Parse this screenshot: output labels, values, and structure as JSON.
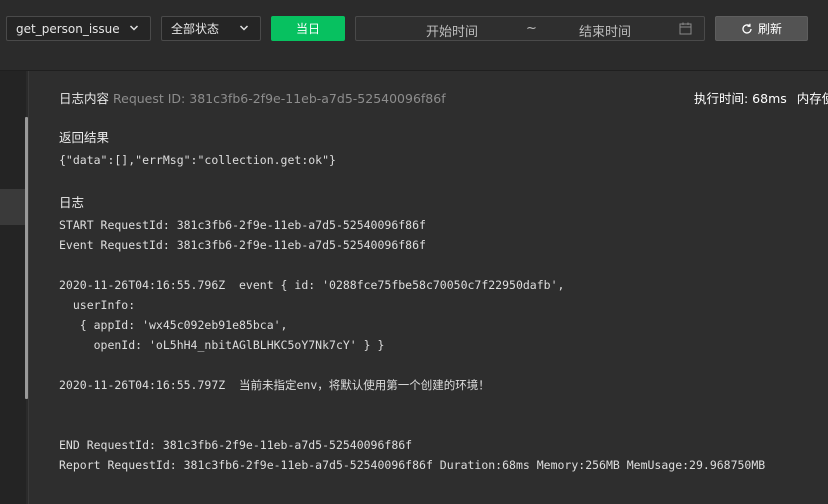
{
  "toolbar": {
    "function_select": {
      "value": "get_person_issue"
    },
    "status_select": {
      "value": "全部状态"
    },
    "today_label": "当日",
    "range": {
      "start_placeholder": "开始时间",
      "separator": "~",
      "end_placeholder": "结束时间"
    },
    "refresh_label": "刷新"
  },
  "log": {
    "title": "日志内容",
    "request_id_label": "Request ID: 381c3fb6-2f9e-11eb-a7d5-52540096f86f",
    "exec_time": "执行时间: 68ms",
    "memory_partial": "内存使",
    "result_title": "返回结果",
    "result_body": "{\"data\":[],\"errMsg\":\"collection.get:ok\"}",
    "logs_title": "日志",
    "lines": [
      "START RequestId: 381c3fb6-2f9e-11eb-a7d5-52540096f86f",
      "Event RequestId: 381c3fb6-2f9e-11eb-a7d5-52540096f86f",
      "2020-11-26T04:16:55.796Z  event { id: '0288fce75fbe58c70050c7f22950dafb',",
      "  userInfo:",
      "   { appId: 'wx45c092eb91e85bca',",
      "     openId: 'oL5hH4_nbitAGlBLHKC5oY7Nk7cY' } }",
      "2020-11-26T04:16:55.797Z  当前未指定env，将默认使用第一个创建的环境！",
      "END RequestId: 381c3fb6-2f9e-11eb-a7d5-52540096f86f",
      "Report RequestId: 381c3fb6-2f9e-11eb-a7d5-52540096f86f Duration:68ms Memory:256MB MemUsage:29.968750MB"
    ]
  },
  "colors": {
    "accent_green": "#07c160",
    "background": "#2b2b2b"
  },
  "icons": [
    "chevron-down-icon",
    "calendar-icon",
    "refresh-icon"
  ]
}
